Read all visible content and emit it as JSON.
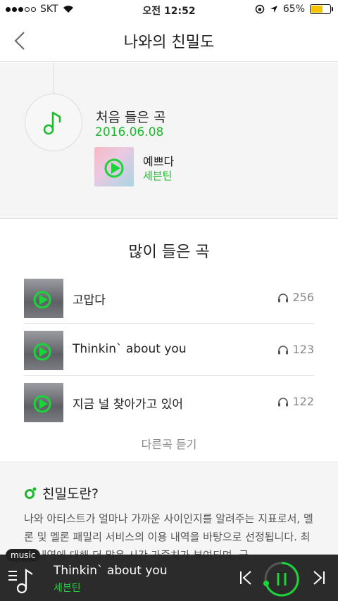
{
  "status_bar": {
    "carrier": "SKT",
    "time": "오전 12:52",
    "battery": "65%",
    "battery_level": 0.65
  },
  "nav": {
    "title": "나와의 친밀도"
  },
  "first_listened": {
    "label": "처음 들은 곡",
    "date": "2016.06.08",
    "song": "예쁘다",
    "artist": "세븐틴"
  },
  "most_listened": {
    "title": "많이 들은 곡",
    "tracks": [
      {
        "name": "고맙다",
        "plays": "256"
      },
      {
        "name": "Thinkin` about you",
        "plays": "123"
      },
      {
        "name": "지금 널 찾아가고 있어",
        "plays": "122"
      }
    ],
    "more_label": "다른곡 듣기"
  },
  "about": {
    "heading": "친밀도란?",
    "description": "나와 아티스트가 얼마나 가까운 사이인지를 알려주는 지표로서, 멜론 및 멜론 패밀리 서비스의 이용 내역을 바탕으로 선정됩니다. 최근 내역에 대해 더 많은 시간 가중치가 부여되며, 급"
  },
  "player": {
    "tag": "music",
    "title": "Thinkin` about you",
    "artist": "세븐틴"
  },
  "colors": {
    "accent": "#1bb92c",
    "player_bg": "#222222"
  }
}
